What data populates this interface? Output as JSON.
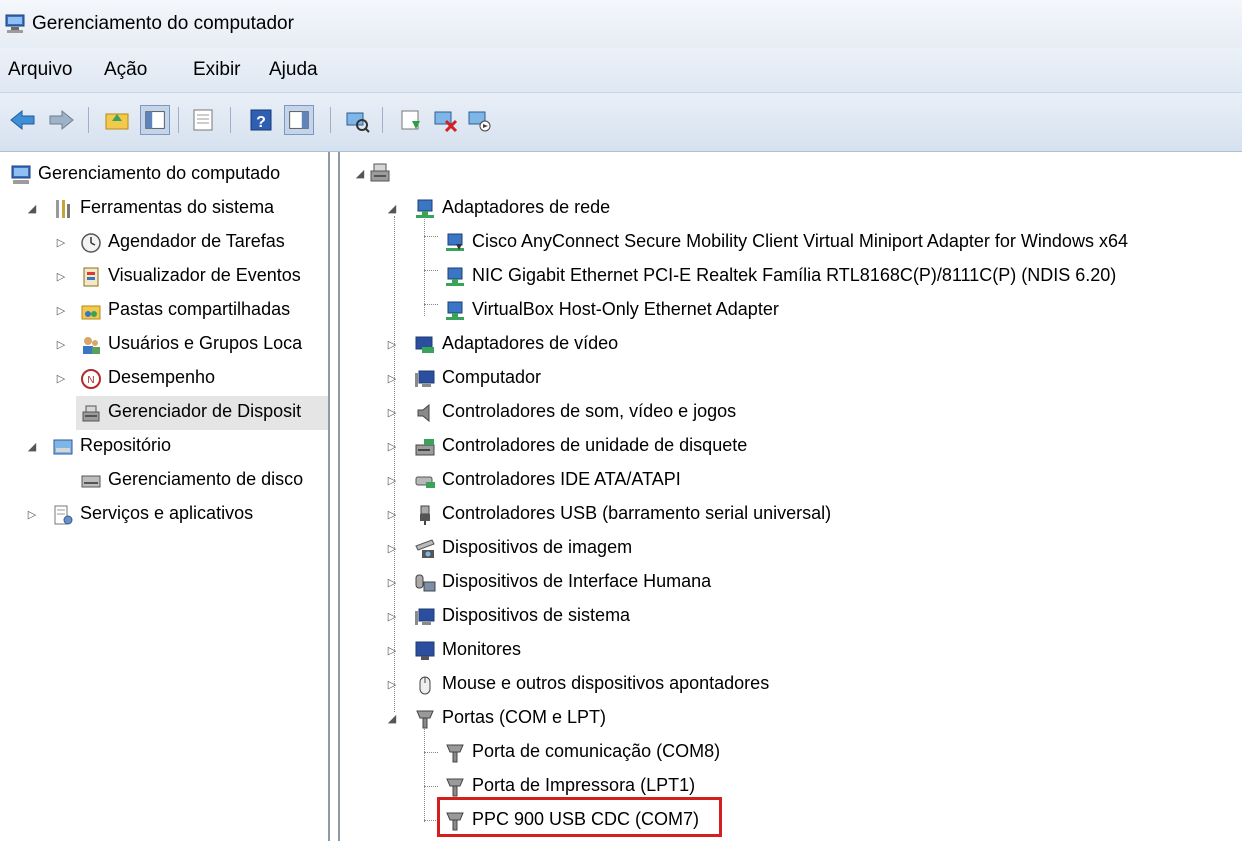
{
  "window": {
    "title": "Gerenciamento do computador",
    "title_icon": "computer-management-icon"
  },
  "menu": {
    "items": [
      "Arquivo",
      "Ação",
      "Exibir",
      "Ajuda"
    ]
  },
  "toolbar": {
    "buttons": [
      "back-arrow-icon",
      "forward-arrow-icon",
      "up-folder-icon",
      "show-hide-tree-icon",
      "properties-icon",
      "help-icon",
      "action-pane-icon",
      "scan-hardware-icon",
      "update-driver-icon",
      "uninstall-device-icon",
      "disable-device-icon"
    ]
  },
  "left_tree": {
    "root": "Gerenciamento do computado",
    "system_tools": "Ferramentas do sistema",
    "task_scheduler": "Agendador de Tarefas",
    "event_viewer": "Visualizador de Eventos",
    "shared_folders": "Pastas compartilhadas",
    "local_users": "Usuários e Grupos Loca",
    "performance": "Desempenho",
    "device_manager": "Gerenciador de Disposit",
    "storage": "Repositório",
    "disk_management": "Gerenciamento de disco",
    "services_apps": "Serviços e aplicativos"
  },
  "device_tree": {
    "network_adapters": "Adaptadores de rede",
    "net_children": [
      "Cisco AnyConnect Secure Mobility Client Virtual Miniport Adapter for Windows x64",
      "NIC Gigabit Ethernet PCI-E Realtek Família RTL8168C(P)/8111C(P) (NDIS 6.20)",
      "VirtualBox Host-Only Ethernet Adapter"
    ],
    "display_adapters": "Adaptadores de vídeo",
    "computer": "Computador",
    "sound": "Controladores de som, vídeo e jogos",
    "floppy": "Controladores de unidade de disquete",
    "ide": "Controladores IDE ATA/ATAPI",
    "usb": "Controladores USB (barramento serial universal)",
    "imaging": "Dispositivos de imagem",
    "hid": "Dispositivos de Interface Humana",
    "system_devices": "Dispositivos de sistema",
    "monitors": "Monitores",
    "mice": "Mouse e outros dispositivos apontadores",
    "ports": "Portas (COM e LPT)",
    "port_children": [
      "Porta de comunicação (COM8)",
      "Porta de Impressora (LPT1)",
      "PPC 900 USB CDC (COM7)"
    ]
  },
  "colors": {
    "highlight_border": "#d51e1e",
    "selection_bg": "#e5e5e5",
    "toolbar_bg": "#dfe8f3"
  }
}
